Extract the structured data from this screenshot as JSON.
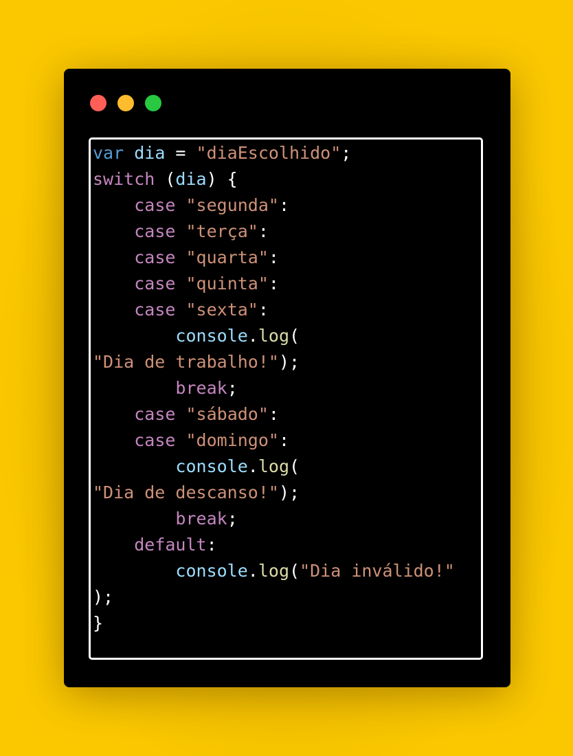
{
  "window_controls": {
    "close_color": "#ff5f57",
    "minimize_color": "#febc2e",
    "maximize_color": "#28c840"
  },
  "colors": {
    "background": "#fbc800",
    "window": "#000000",
    "frame_border": "#ffffff",
    "keyword": "#569cd6",
    "variable": "#9cdcfe",
    "control": "#c586c0",
    "string": "#ce9178",
    "function": "#dcdcaa",
    "punctuation": "#ffffff"
  },
  "code": {
    "language": "javascript",
    "lines": [
      [
        {
          "t": "var",
          "c": "kw"
        },
        {
          "t": " ",
          "c": "punc"
        },
        {
          "t": "dia",
          "c": "var"
        },
        {
          "t": " = ",
          "c": "punc"
        },
        {
          "t": "\"diaEscolhido\"",
          "c": "str"
        },
        {
          "t": ";",
          "c": "punc"
        }
      ],
      [
        {
          "t": "switch",
          "c": "ctrl"
        },
        {
          "t": " (",
          "c": "punc"
        },
        {
          "t": "dia",
          "c": "var"
        },
        {
          "t": ") {",
          "c": "punc"
        }
      ],
      [
        {
          "t": "    ",
          "c": "punc"
        },
        {
          "t": "case",
          "c": "ctrl"
        },
        {
          "t": " ",
          "c": "punc"
        },
        {
          "t": "\"segunda\"",
          "c": "str"
        },
        {
          "t": ":",
          "c": "punc"
        }
      ],
      [
        {
          "t": "    ",
          "c": "punc"
        },
        {
          "t": "case",
          "c": "ctrl"
        },
        {
          "t": " ",
          "c": "punc"
        },
        {
          "t": "\"terça\"",
          "c": "str"
        },
        {
          "t": ":",
          "c": "punc"
        }
      ],
      [
        {
          "t": "    ",
          "c": "punc"
        },
        {
          "t": "case",
          "c": "ctrl"
        },
        {
          "t": " ",
          "c": "punc"
        },
        {
          "t": "\"quarta\"",
          "c": "str"
        },
        {
          "t": ":",
          "c": "punc"
        }
      ],
      [
        {
          "t": "    ",
          "c": "punc"
        },
        {
          "t": "case",
          "c": "ctrl"
        },
        {
          "t": " ",
          "c": "punc"
        },
        {
          "t": "\"quinta\"",
          "c": "str"
        },
        {
          "t": ":",
          "c": "punc"
        }
      ],
      [
        {
          "t": "    ",
          "c": "punc"
        },
        {
          "t": "case",
          "c": "ctrl"
        },
        {
          "t": " ",
          "c": "punc"
        },
        {
          "t": "\"sexta\"",
          "c": "str"
        },
        {
          "t": ":",
          "c": "punc"
        }
      ],
      [
        {
          "t": "        ",
          "c": "punc"
        },
        {
          "t": "console",
          "c": "obj"
        },
        {
          "t": ".",
          "c": "punc"
        },
        {
          "t": "log",
          "c": "fn"
        },
        {
          "t": "(",
          "c": "punc"
        }
      ],
      [
        {
          "t": "\"Dia de trabalho!\"",
          "c": "str"
        },
        {
          "t": ");",
          "c": "punc"
        }
      ],
      [
        {
          "t": "        ",
          "c": "punc"
        },
        {
          "t": "break",
          "c": "ctrl"
        },
        {
          "t": ";",
          "c": "punc"
        }
      ],
      [
        {
          "t": "    ",
          "c": "punc"
        },
        {
          "t": "case",
          "c": "ctrl"
        },
        {
          "t": " ",
          "c": "punc"
        },
        {
          "t": "\"sábado\"",
          "c": "str"
        },
        {
          "t": ":",
          "c": "punc"
        }
      ],
      [
        {
          "t": "    ",
          "c": "punc"
        },
        {
          "t": "case",
          "c": "ctrl"
        },
        {
          "t": " ",
          "c": "punc"
        },
        {
          "t": "\"domingo\"",
          "c": "str"
        },
        {
          "t": ":",
          "c": "punc"
        }
      ],
      [
        {
          "t": "        ",
          "c": "punc"
        },
        {
          "t": "console",
          "c": "obj"
        },
        {
          "t": ".",
          "c": "punc"
        },
        {
          "t": "log",
          "c": "fn"
        },
        {
          "t": "(",
          "c": "punc"
        }
      ],
      [
        {
          "t": "\"Dia de descanso!\"",
          "c": "str"
        },
        {
          "t": ");",
          "c": "punc"
        }
      ],
      [
        {
          "t": "        ",
          "c": "punc"
        },
        {
          "t": "break",
          "c": "ctrl"
        },
        {
          "t": ";",
          "c": "punc"
        }
      ],
      [
        {
          "t": "    ",
          "c": "punc"
        },
        {
          "t": "default",
          "c": "ctrl"
        },
        {
          "t": ":",
          "c": "punc"
        }
      ],
      [
        {
          "t": "        ",
          "c": "punc"
        },
        {
          "t": "console",
          "c": "obj"
        },
        {
          "t": ".",
          "c": "punc"
        },
        {
          "t": "log",
          "c": "fn"
        },
        {
          "t": "(",
          "c": "punc"
        },
        {
          "t": "\"Dia inválido!\"",
          "c": "str"
        }
      ],
      [
        {
          "t": ");",
          "c": "punc"
        }
      ],
      [
        {
          "t": "}",
          "c": "punc"
        }
      ]
    ]
  }
}
